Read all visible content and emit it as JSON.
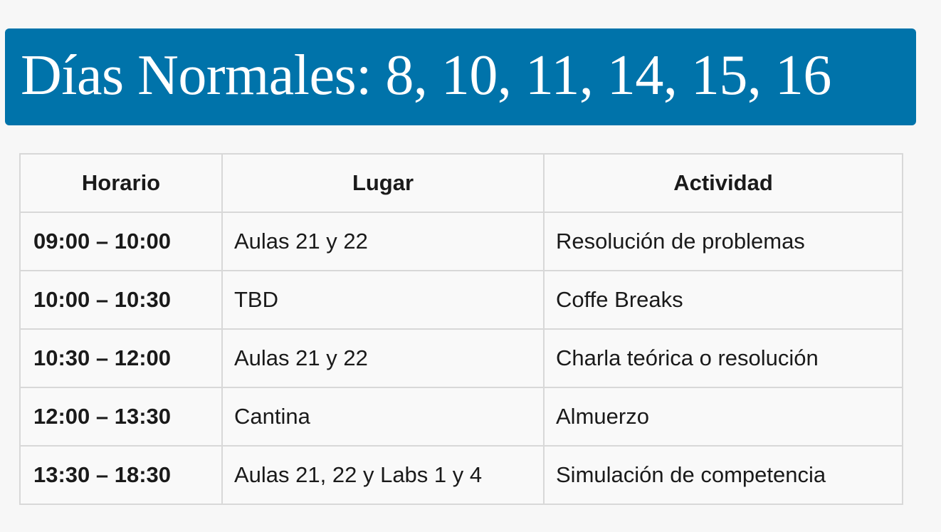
{
  "banner": {
    "title": "Días Normales: 8, 10, 11, 14, 15, 16",
    "background_color": "#0073aa"
  },
  "table": {
    "headers": [
      "Horario",
      "Lugar",
      "Actividad"
    ],
    "rows": [
      [
        "09:00 – 10:00",
        "Aulas 21 y 22",
        "Resolución de problemas"
      ],
      [
        "10:00 – 10:30",
        "TBD",
        "Coffe Breaks"
      ],
      [
        "10:30 – 12:00",
        "Aulas 21 y 22",
        "Charla teórica o resolución"
      ],
      [
        "12:00 – 13:30",
        "Cantina",
        "Almuerzo"
      ],
      [
        "13:30 – 18:30",
        "Aulas 21, 22 y Labs 1 y 4",
        "Simulación de competencia"
      ]
    ]
  }
}
